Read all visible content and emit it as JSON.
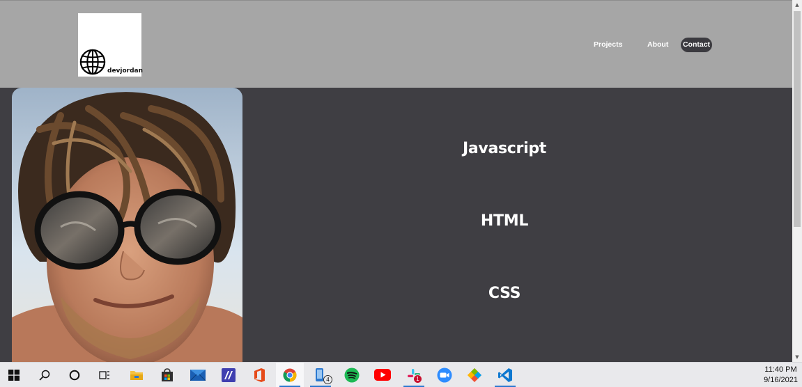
{
  "site": {
    "logo_text": "devjordan",
    "nav": {
      "projects": "Projects",
      "about": "About",
      "contact": "Contact"
    },
    "skills": [
      "Javascript",
      "HTML",
      "CSS"
    ]
  },
  "taskbar": {
    "apps": [
      {
        "name": "file-explorer-icon"
      },
      {
        "name": "microsoft-store-icon"
      },
      {
        "name": "mail-icon"
      },
      {
        "name": "powerapps-icon"
      },
      {
        "name": "office-icon"
      },
      {
        "name": "chrome-icon"
      },
      {
        "name": "phone-link-icon",
        "badge": "4"
      },
      {
        "name": "spotify-icon"
      },
      {
        "name": "youtube-icon"
      },
      {
        "name": "slack-icon",
        "badge": "1"
      },
      {
        "name": "zoom-icon"
      },
      {
        "name": "git-icon"
      },
      {
        "name": "vscode-icon"
      }
    ],
    "badges": {
      "phone": "4",
      "slack": "1"
    },
    "clock": {
      "time": "11:40 PM",
      "date": "9/16/2021"
    }
  },
  "colors": {
    "header_bg": "#a6a6a6",
    "page_bg": "#3f3e43",
    "contact_pill": "#3b3a3f",
    "taskbar_bg": "#e9e9ec",
    "accent": "#2b78d0"
  }
}
